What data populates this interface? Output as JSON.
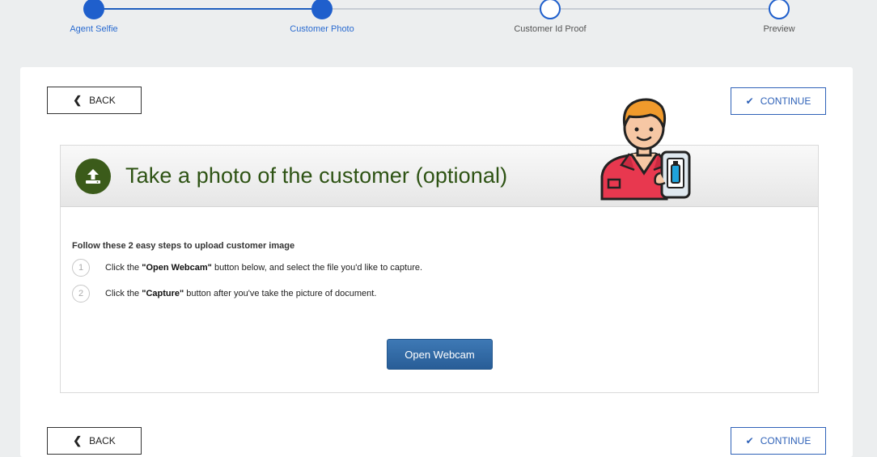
{
  "stepper": {
    "steps": [
      {
        "label": "Agent Selfie",
        "status": "done"
      },
      {
        "label": "Customer Photo",
        "status": "done"
      },
      {
        "label": "Customer Id Proof",
        "status": "todo"
      },
      {
        "label": "Preview",
        "status": "todo"
      }
    ]
  },
  "nav": {
    "back_label": "BACK",
    "continue_label": "CONTINUE"
  },
  "panel": {
    "title": "Take a photo of the customer (optional)",
    "instructions_title": "Follow these 2 easy steps to upload customer image",
    "steps": [
      {
        "num": "1",
        "prefix": "Click the ",
        "bold": "\"Open Webcam\"",
        "suffix": " button below, and select the file you'd like to capture."
      },
      {
        "num": "2",
        "prefix": "Click the ",
        "bold": "\"Capture\"",
        "suffix": " button after you've take the picture of document."
      }
    ],
    "webcam_button": "Open Webcam"
  },
  "icons": {
    "back": "chevron-left-icon",
    "continue": "check-icon",
    "upload": "upload-icon",
    "illustration": "customer-with-phone-icon"
  },
  "colors": {
    "accent": "#1f5fcc",
    "title_green": "#2e5314",
    "webcam_button": "#2f6aa6"
  }
}
